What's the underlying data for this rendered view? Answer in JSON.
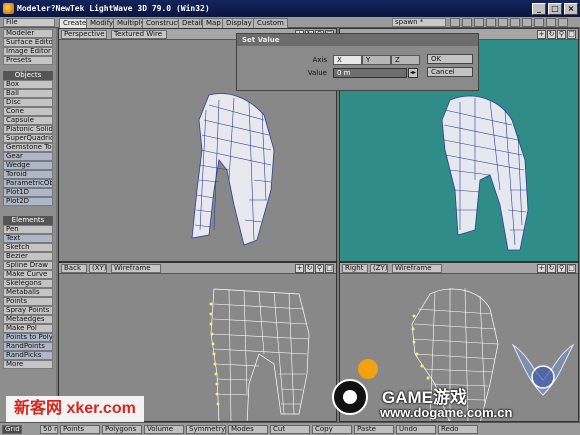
{
  "window": {
    "title": "Modeler?NewTek LightWave 3D 79.0 (Win32)",
    "buttons": [
      "_",
      "□",
      "×"
    ]
  },
  "toolbar": {
    "file": "File",
    "modeler": "Modeler",
    "tabs": [
      "Create",
      "Modify",
      "Multiply",
      "Construct",
      "Detail",
      "Map",
      "Display",
      "Custom"
    ],
    "active_tab": "Create",
    "object_name": "spawn *"
  },
  "left_panel": {
    "top_items": [
      "Surface Editor",
      "Image Editor",
      "Presets"
    ],
    "objects_header": "Objects",
    "objects": [
      "Box",
      "Ball",
      "Disc",
      "Cone",
      "Capsule",
      "Platonic Solid",
      "SuperQuadric",
      "Gemstone Tool",
      "Gear",
      "Wedge",
      "Toroid",
      "ParametricObj",
      "Plot1D",
      "Plot2D"
    ],
    "elements_header": "Elements",
    "elements": [
      "Pen",
      "Text",
      "Sketch",
      "Bezier",
      "Spline Draw",
      "Make Curve",
      "Skelegons",
      "Metaballs",
      "Points",
      "Spray Points",
      "Metaedges",
      "Make Pol",
      "Points to Polys",
      "RandPoints",
      "RandPicks",
      "More"
    ]
  },
  "viewports": {
    "top_left": {
      "view": "Perspective",
      "mode": "Textured Wire"
    },
    "bottom_left": {
      "view": "Back",
      "axis": "(XY)",
      "mode": "Wireframe"
    },
    "bottom_right": {
      "view": "Right",
      "axis": "(ZY)",
      "mode": "Wireframe"
    }
  },
  "dialog": {
    "title": "Set Value",
    "axis_label": "Axis",
    "axes": [
      "X",
      "Y",
      "Z"
    ],
    "selected_axis": "X",
    "value_label": "Value",
    "value": "0 m",
    "ok": "OK",
    "cancel": "Cancel"
  },
  "bottom_bar": {
    "grid_label": "Grid",
    "grid_value": "50 m",
    "sel_modes": [
      "Points",
      "Polygons",
      "Volume"
    ],
    "symmetry": "Symmetry",
    "modes": "Modes",
    "actions": [
      "Cut",
      "Copy",
      "Paste",
      "Undo",
      "Redo"
    ]
  },
  "watermarks": {
    "left": "新客网 xker.com",
    "right_brand": "GAME游戏",
    "right_url": "www.dogame.com.cn"
  },
  "colors": {
    "accent_teal": "#2f8c86",
    "viewport_gray": "#888888",
    "wire_blue": "#2a3f9a",
    "point_yellow": "#f0f070"
  }
}
